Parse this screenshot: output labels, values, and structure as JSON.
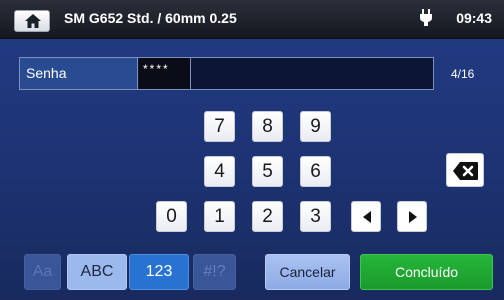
{
  "header": {
    "title": "SM G652 Std. / 60mm 0.25",
    "time": "09:43",
    "home_icon": "home-icon",
    "power_icon": "plug-icon"
  },
  "input": {
    "label": "Senha",
    "value": "****",
    "counter": "4/16"
  },
  "keypad": {
    "k7": "7",
    "k8": "8",
    "k9": "9",
    "k4": "4",
    "k5": "5",
    "k6": "6",
    "k0": "0",
    "k1": "1",
    "k2": "2",
    "k3": "3"
  },
  "modes": {
    "aa": "Aa",
    "abc": "ABC",
    "num": "123",
    "sym": "#!?"
  },
  "actions": {
    "cancel": "Cancelar",
    "done": "Concluído"
  },
  "colors": {
    "background": "#1d3373",
    "done": "#1fa834",
    "active_mode": "#2872d1"
  }
}
